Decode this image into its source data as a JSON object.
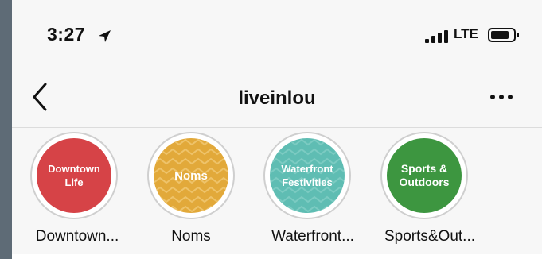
{
  "status_bar": {
    "time": "3:27",
    "network": "LTE",
    "icons": [
      "location-arrow-icon",
      "signal-bars-icon",
      "battery-icon"
    ]
  },
  "nav": {
    "title": "liveinlou",
    "icons": [
      "chevron-left-icon",
      "more-horizontal-icon"
    ]
  },
  "highlights": [
    {
      "cover_text": "Downtown Life",
      "label": "Downtown...",
      "color": "#d64347"
    },
    {
      "cover_text": "Noms",
      "label": "Noms",
      "color": "#e2a93a"
    },
    {
      "cover_text": "Waterfront Festivities",
      "label": "Waterfront...",
      "color": "#5fbdb3"
    },
    {
      "cover_text": "Sports & Outdoors",
      "label": "Sports&Out...",
      "color": "#3d9640"
    }
  ]
}
